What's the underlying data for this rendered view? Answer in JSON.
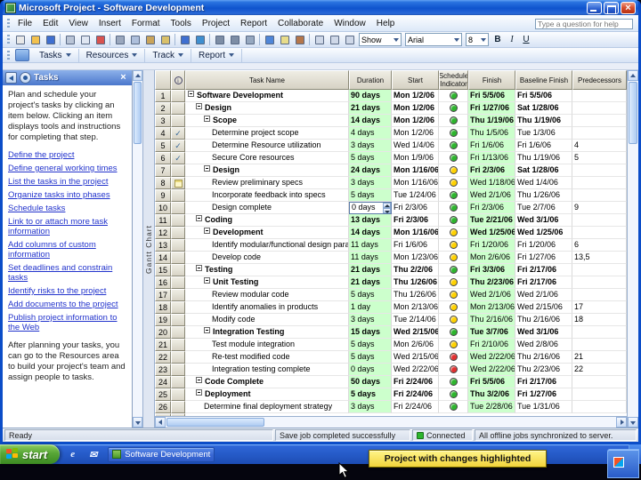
{
  "window": {
    "title": "Microsoft Project - Software Development"
  },
  "menu": {
    "items": [
      "File",
      "Edit",
      "View",
      "Insert",
      "Format",
      "Tools",
      "Project",
      "Report",
      "Collaborate",
      "Window",
      "Help"
    ],
    "help_placeholder": "Type a question for help"
  },
  "toolbar_standard": {
    "icons": [
      {
        "name": "new-document-icon",
        "c": "#e8e8e8"
      },
      {
        "name": "open-folder-icon",
        "c": "#f2c14e"
      },
      {
        "name": "save-icon",
        "c": "#3f6fd0"
      },
      {
        "name": "sep"
      },
      {
        "name": "print-icon",
        "c": "#b9c4d6"
      },
      {
        "name": "print-preview-icon",
        "c": "#dfe6f2"
      },
      {
        "name": "spelling-icon",
        "c": "#d9534f"
      },
      {
        "name": "sep"
      },
      {
        "name": "cut-icon",
        "c": "#9aa7bd"
      },
      {
        "name": "copy-icon",
        "c": "#aebfdb"
      },
      {
        "name": "paste-icon",
        "c": "#caa45a"
      },
      {
        "name": "format-painter-icon",
        "c": "#d9c06a"
      },
      {
        "name": "sep"
      },
      {
        "name": "undo-icon",
        "c": "#3f6fd0"
      },
      {
        "name": "insert-hyperlink-icon",
        "c": "#3f8fd0"
      },
      {
        "name": "sep"
      },
      {
        "name": "link-tasks-icon",
        "c": "#7d8da5"
      },
      {
        "name": "unlink-tasks-icon",
        "c": "#7d8da5"
      },
      {
        "name": "split-task-icon",
        "c": "#96a8c0"
      },
      {
        "name": "sep"
      },
      {
        "name": "task-information-icon",
        "c": "#4f86d8"
      },
      {
        "name": "task-notes-icon",
        "c": "#e8dc8a"
      },
      {
        "name": "assign-resources-icon",
        "c": "#b5764a"
      },
      {
        "name": "sep"
      },
      {
        "name": "zoom-in-icon",
        "c": "#cfd8e8"
      },
      {
        "name": "zoom-out-icon",
        "c": "#cfd8e8"
      },
      {
        "name": "go-to-task-icon",
        "c": "#cfd8e8"
      }
    ],
    "show_label": "Show",
    "font_name": "Arial",
    "font_size": "8",
    "bold": "B",
    "italic": "I",
    "underline": "U"
  },
  "toolbar_guide": {
    "items": [
      "Tasks",
      "Resources",
      "Track",
      "Report"
    ]
  },
  "view_name": "Gantt Chart",
  "side_pane": {
    "title": "Tasks",
    "intro": "Plan and schedule your project's tasks by clicking an item below. Clicking an item displays tools and instructions for completing that step.",
    "links": [
      "Define the project",
      "Define general working times",
      "List the tasks in the project",
      "Organize tasks into phases",
      "Schedule tasks",
      "Link to or attach more task information",
      "Add columns of custom information",
      "Set deadlines and constrain tasks",
      "Identify risks to the project",
      "Add documents to the project",
      "Publish project information to the Web"
    ],
    "footer": "After planning your tasks, you can go to the Resources area to build your project's team and assign people to tasks."
  },
  "grid": {
    "columns": [
      "Task Name",
      "Duration",
      "Start",
      "Schedule Indicator",
      "Finish",
      "Baseline Finish",
      "Predecessors"
    ],
    "icon_glyphs": {
      "check": "✓"
    },
    "rows": [
      {
        "id": 1,
        "icon": "",
        "lvl": 0,
        "sum": true,
        "name": "Software Development",
        "dur": "90 days",
        "start": "Mon 1/2/06",
        "light": "green",
        "fin": "Fri 5/5/06",
        "base": "Fri 5/5/06",
        "pred": ""
      },
      {
        "id": 2,
        "icon": "",
        "lvl": 1,
        "sum": true,
        "name": "Design",
        "dur": "21 days",
        "start": "Mon 1/2/06",
        "light": "green",
        "fin": "Fri 1/27/06",
        "base": "Sat 1/28/06",
        "pred": ""
      },
      {
        "id": 3,
        "icon": "",
        "lvl": 2,
        "sum": true,
        "name": "Scope",
        "dur": "14 days",
        "start": "Mon 1/2/06",
        "light": "green",
        "fin": "Thu 1/19/06",
        "base": "Thu 1/19/06",
        "pred": ""
      },
      {
        "id": 4,
        "icon": "check",
        "lvl": 3,
        "sum": false,
        "name": "Determine project scope",
        "dur": "4 days",
        "start": "Mon 1/2/06",
        "light": "green",
        "fin": "Thu 1/5/06",
        "base": "Tue 1/3/06",
        "pred": ""
      },
      {
        "id": 5,
        "icon": "check",
        "lvl": 3,
        "sum": false,
        "name": "Determine Resource utilization",
        "dur": "3 days",
        "start": "Wed 1/4/06",
        "light": "green",
        "fin": "Fri 1/6/06",
        "base": "Fri 1/6/06",
        "pred": "4"
      },
      {
        "id": 6,
        "icon": "check",
        "lvl": 3,
        "sum": false,
        "name": "Secure Core resources",
        "dur": "5 days",
        "start": "Mon 1/9/06",
        "light": "green",
        "fin": "Fri 1/13/06",
        "base": "Thu 1/19/06",
        "pred": "5"
      },
      {
        "id": 7,
        "icon": "",
        "lvl": 2,
        "sum": true,
        "name": "Design",
        "dur": "24 days",
        "start": "Mon 1/16/06",
        "light": "yellow",
        "fin": "Fri 2/3/06",
        "base": "Sat 1/28/06",
        "pred": ""
      },
      {
        "id": 8,
        "icon": "note",
        "lvl": 3,
        "sum": false,
        "name": "Review preliminary specs",
        "dur": "3 days",
        "start": "Mon 1/16/06",
        "light": "yellow",
        "fin": "Wed 1/18/06",
        "base": "Wed 1/4/06",
        "pred": ""
      },
      {
        "id": 9,
        "icon": "",
        "lvl": 3,
        "sum": false,
        "name": "Incorporate feedback into specs",
        "dur": "5 days",
        "start": "Tue 1/24/06",
        "light": "green",
        "fin": "Wed 2/1/06",
        "base": "Thu 1/26/06",
        "pred": ""
      },
      {
        "id": 10,
        "icon": "",
        "lvl": 3,
        "sum": false,
        "edit": true,
        "name": "Design complete",
        "dur": "0 days",
        "start": "Fri 2/3/06",
        "light": "green",
        "fin": "Fri 2/3/06",
        "base": "Tue 2/7/06",
        "pred": "9"
      },
      {
        "id": 11,
        "icon": "",
        "lvl": 1,
        "sum": true,
        "name": "Coding",
        "dur": "13 days",
        "start": "Fri 2/3/06",
        "light": "green",
        "fin": "Tue 2/21/06",
        "base": "Wed 3/1/06",
        "pred": ""
      },
      {
        "id": 12,
        "icon": "",
        "lvl": 2,
        "sum": true,
        "name": "Development",
        "dur": "14 days",
        "start": "Mon 1/16/06",
        "light": "yellow",
        "fin": "Wed 1/25/06",
        "base": "Wed 1/25/06",
        "pred": ""
      },
      {
        "id": 13,
        "icon": "",
        "lvl": 3,
        "sum": false,
        "name": "Identify modular/functional design parameters",
        "dur": "11 days",
        "start": "Fri 1/6/06",
        "light": "yellow",
        "fin": "Fri 1/20/06",
        "base": "Fri 1/20/06",
        "pred": "6"
      },
      {
        "id": 14,
        "icon": "",
        "lvl": 3,
        "sum": false,
        "name": "Develop code",
        "dur": "11 days",
        "start": "Mon 1/23/06",
        "light": "yellow",
        "fin": "Mon 2/6/06",
        "base": "Fri 1/27/06",
        "pred": "13,5"
      },
      {
        "id": 15,
        "icon": "",
        "lvl": 1,
        "sum": true,
        "name": "Testing",
        "dur": "21 days",
        "start": "Thu 2/2/06",
        "light": "green",
        "fin": "Fri 3/3/06",
        "base": "Fri 2/17/06",
        "pred": ""
      },
      {
        "id": 16,
        "icon": "",
        "lvl": 2,
        "sum": true,
        "name": "Unit Testing",
        "dur": "21 days",
        "start": "Thu 1/26/06",
        "light": "yellow",
        "fin": "Thu 2/23/06",
        "base": "Fri 2/17/06",
        "pred": ""
      },
      {
        "id": 17,
        "icon": "",
        "lvl": 3,
        "sum": false,
        "name": "Review modular code",
        "dur": "5 days",
        "start": "Thu 1/26/06",
        "light": "yellow",
        "fin": "Wed 2/1/06",
        "base": "Wed 2/1/06",
        "pred": ""
      },
      {
        "id": 18,
        "icon": "",
        "lvl": 3,
        "sum": false,
        "name": "Identify anomalies in products",
        "dur": "1 day",
        "start": "Mon 2/13/06",
        "light": "yellow",
        "fin": "Mon 2/13/06",
        "base": "Wed 2/15/06",
        "pred": "17"
      },
      {
        "id": 19,
        "icon": "",
        "lvl": 3,
        "sum": false,
        "name": "Modify code",
        "dur": "3 days",
        "start": "Tue 2/14/06",
        "light": "yellow",
        "fin": "Thu 2/16/06",
        "base": "Thu 2/16/06",
        "pred": "18"
      },
      {
        "id": 20,
        "icon": "",
        "lvl": 2,
        "sum": true,
        "name": "Integration Testing",
        "dur": "15 days",
        "start": "Wed 2/15/06",
        "light": "green",
        "fin": "Tue 3/7/06",
        "base": "Wed 3/1/06",
        "pred": ""
      },
      {
        "id": 21,
        "icon": "",
        "lvl": 3,
        "sum": false,
        "name": "Test module integration",
        "dur": "5 days",
        "start": "Mon 2/6/06",
        "light": "yellow",
        "fin": "Fri 2/10/06",
        "base": "Wed 2/8/06",
        "pred": ""
      },
      {
        "id": 22,
        "icon": "",
        "lvl": 3,
        "sum": false,
        "name": "Re-test modified code",
        "dur": "5 days",
        "start": "Wed 2/15/06",
        "light": "red",
        "fin": "Wed 2/22/06",
        "base": "Thu 2/16/06",
        "pred": "21"
      },
      {
        "id": 23,
        "icon": "",
        "lvl": 3,
        "sum": false,
        "name": "Integration testing complete",
        "dur": "0 days",
        "start": "Wed 2/22/06",
        "light": "red",
        "fin": "Wed 2/22/06",
        "base": "Thu 2/23/06",
        "pred": "22"
      },
      {
        "id": 24,
        "icon": "",
        "lvl": 1,
        "sum": true,
        "name": "Code Complete",
        "dur": "50 days",
        "start": "Fri 2/24/06",
        "light": "green",
        "fin": "Fri 5/5/06",
        "base": "Fri 2/17/06",
        "pred": ""
      },
      {
        "id": 25,
        "icon": "",
        "lvl": 1,
        "sum": true,
        "name": "Deployment",
        "dur": "5 days",
        "start": "Fri 2/24/06",
        "light": "green",
        "fin": "Thu 3/2/06",
        "base": "Fri 1/27/06",
        "pred": ""
      },
      {
        "id": 26,
        "icon": "",
        "lvl": 2,
        "sum": false,
        "name": "Determine final deployment strategy",
        "dur": "3 days",
        "start": "Fri 2/24/06",
        "light": "green",
        "fin": "Tue 2/28/06",
        "base": "Tue 1/31/06",
        "pred": ""
      }
    ]
  },
  "status": {
    "ready": "Ready",
    "save_job": "Save job completed successfully",
    "connected": "Connected",
    "sync": "All offline jobs synchronized to server."
  },
  "taskbar": {
    "start_label": "start",
    "window_button": "Software Development",
    "quick_launch": [
      {
        "name": "internet-explorer-icon",
        "glyph": "e"
      },
      {
        "name": "outlook-icon",
        "glyph": "✉"
      }
    ]
  },
  "callout": {
    "label": "Project with changes highlighted"
  },
  "colors": {
    "change_highlight": "#ccffcc",
    "stoplight_green": "#2db52d",
    "stoplight_yellow": "#ffd200",
    "stoplight_red": "#e23030",
    "link": "#2233cc"
  }
}
